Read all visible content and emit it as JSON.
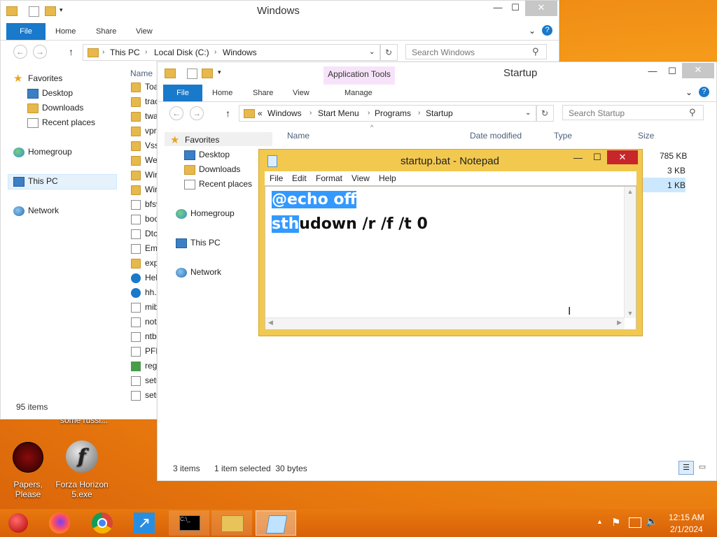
{
  "explorer_windows": {
    "title": "Windows",
    "ribbon_tabs": [
      "File",
      "Home",
      "Share",
      "View"
    ],
    "breadcrumb": [
      "This PC",
      "Local Disk (C:)",
      "Windows"
    ],
    "search_placeholder": "Search Windows",
    "nav": {
      "favorites": "Favorites",
      "desktop": "Desktop",
      "downloads": "Downloads",
      "recent": "Recent places",
      "homegroup": "Homegroup",
      "this_pc": "This PC",
      "network": "Network"
    },
    "column_name": "Name",
    "files": [
      "Toa",
      "trac",
      "twa",
      "vpr",
      "Vss",
      "We",
      "Wir",
      "Wir",
      "bfsv",
      "boo",
      "Dtc",
      "Em",
      "exp",
      "Hel",
      "hh.",
      "mib",
      "not",
      "ntb",
      "PFR",
      "reg",
      "setu",
      "setu"
    ],
    "status": "95 items"
  },
  "explorer_startup": {
    "title": "Startup",
    "context_tab": "Application Tools",
    "ribbon_tabs": [
      "File",
      "Home",
      "Share",
      "View",
      "Manage"
    ],
    "breadcrumb": [
      "«",
      "Windows",
      "Start Menu",
      "Programs",
      "Startup"
    ],
    "search_placeholder": "Search Startup",
    "nav": {
      "favorites": "Favorites",
      "desktop": "Desktop",
      "downloads": "Downloads",
      "recent": "Recent places",
      "homegroup": "Homegroup",
      "this_pc": "This PC",
      "network": "Network"
    },
    "columns": [
      "Name",
      "Date modified",
      "Type",
      "Size"
    ],
    "sizes": [
      "785 KB",
      "3 KB",
      "1 KB"
    ],
    "status_items": "3 items",
    "status_selected": "1 item selected  30 bytes"
  },
  "notepad": {
    "title": "startup.bat - Notepad",
    "menu": [
      "File",
      "Edit",
      "Format",
      "View",
      "Help"
    ],
    "line1": "@echo off",
    "line2_selected": "sth",
    "line2_rest": "udown /r /f /t 0"
  },
  "desktop_icons": {
    "top_label": "some russi...",
    "icon1": "Papers, Please",
    "icon2": "Forza Horizon 5.exe"
  },
  "taskbar": {
    "time": "12:15 AM",
    "date": "2/1/2024",
    "tray_up": "▲"
  },
  "colors": {
    "accent": "#1979ca",
    "notepad_frame": "#f2c84f",
    "selection": "#3399ff",
    "taskbar": "#e06c0a"
  }
}
